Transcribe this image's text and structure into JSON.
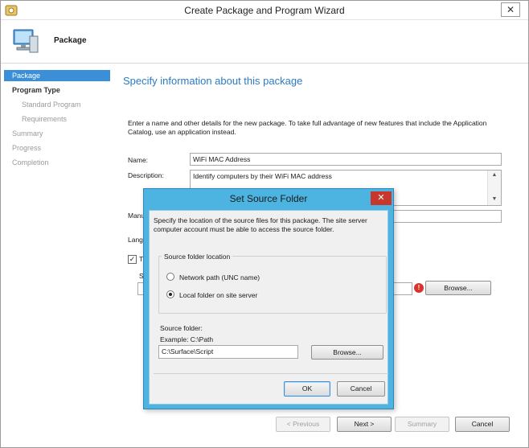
{
  "window": {
    "title": "Create Package and Program Wizard",
    "close_glyph": "✕"
  },
  "header": {
    "title": "Package"
  },
  "nav": {
    "items": [
      {
        "label": "Package",
        "state": "active",
        "level": 0
      },
      {
        "label": "Program Type",
        "state": "current",
        "level": 0
      },
      {
        "label": "Standard Program",
        "state": "pending",
        "level": 1
      },
      {
        "label": "Requirements",
        "state": "pending",
        "level": 1
      },
      {
        "label": "Summary",
        "state": "pending",
        "level": 0
      },
      {
        "label": "Progress",
        "state": "pending",
        "level": 0
      },
      {
        "label": "Completion",
        "state": "pending",
        "level": 0
      }
    ]
  },
  "page": {
    "heading": "Specify information about this package",
    "intro": "Enter a name and other details for the new package. To take full advantage of new features that include the Application Catalog, use an application instead.",
    "name_label": "Name:",
    "name_value": "WiFi MAC Address",
    "description_label": "Description:",
    "description_value": "Identify computers by their WiFi MAC address",
    "manufacturer_label_partial": "Manu",
    "language_label_partial": "Lang",
    "checkbox_label_partial": "T",
    "checkbox_checked_glyph": "✓",
    "source_label_partial": "S",
    "browse_label": "Browse..."
  },
  "footer": {
    "previous_label": "< Previous",
    "next_label": "Next >",
    "summary_label": "Summary",
    "cancel_label": "Cancel"
  },
  "dialog": {
    "title": "Set Source Folder",
    "close_glyph": "✕",
    "description": "Specify the location of the source files for this package. The site server computer account must be able to access the source folder.",
    "group_label": "Source folder location",
    "options": [
      {
        "label": "Network path (UNC name)",
        "selected": false
      },
      {
        "label": "Local folder on site server",
        "selected": true
      }
    ],
    "source_folder_label": "Source folder:",
    "example_text": "Example: C:\\Path",
    "source_folder_value": "C:\\Surface\\Script",
    "browse_label": "Browse...",
    "ok_label": "OK",
    "cancel_label": "Cancel"
  },
  "colors": {
    "accent": "#3a8fd8",
    "heading": "#2a7bc4",
    "dialog_frame": "#4db3e0",
    "close_red": "#c7372b",
    "warning": "#d9342b"
  },
  "icons": [
    "app-icon",
    "computer-icon",
    "close-icon",
    "warning-icon",
    "scroll-up-icon",
    "scroll-down-icon"
  ]
}
